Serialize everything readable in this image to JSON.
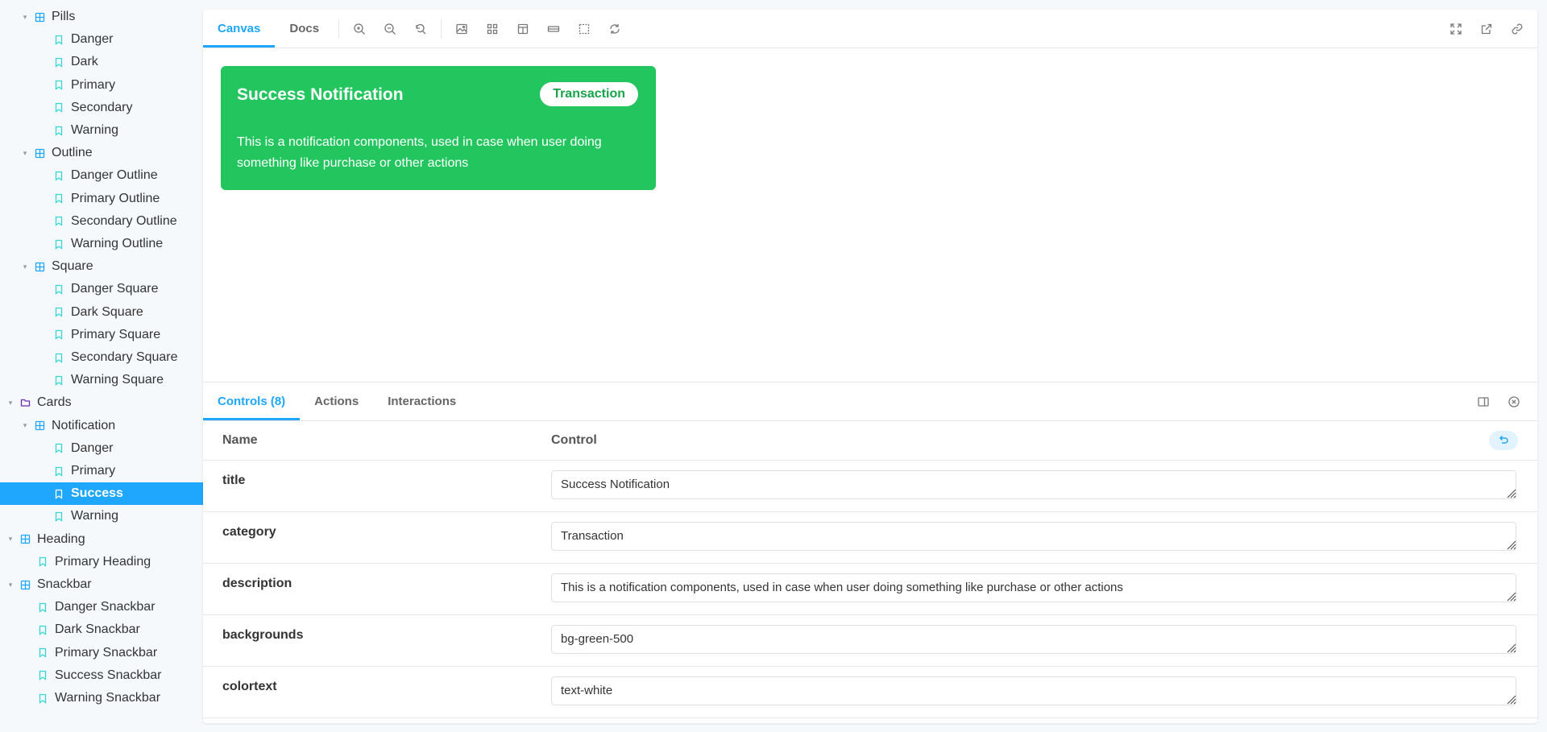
{
  "sidebar": {
    "items": [
      {
        "label": "Pills",
        "type": "component",
        "caret": "▾"
      },
      {
        "label": "Danger",
        "type": "story"
      },
      {
        "label": "Dark",
        "type": "story"
      },
      {
        "label": "Primary",
        "type": "story"
      },
      {
        "label": "Secondary",
        "type": "story"
      },
      {
        "label": "Warning",
        "type": "story"
      },
      {
        "label": "Outline",
        "type": "component",
        "caret": "▾"
      },
      {
        "label": "Danger Outline",
        "type": "story"
      },
      {
        "label": "Primary Outline",
        "type": "story"
      },
      {
        "label": "Secondary Outline",
        "type": "story"
      },
      {
        "label": "Warning Outline",
        "type": "story"
      },
      {
        "label": "Square",
        "type": "component",
        "caret": "▾"
      },
      {
        "label": "Danger Square",
        "type": "story"
      },
      {
        "label": "Dark Square",
        "type": "story"
      },
      {
        "label": "Primary Square",
        "type": "story"
      },
      {
        "label": "Secondary Square",
        "type": "story"
      },
      {
        "label": "Warning Square",
        "type": "story"
      },
      {
        "label": "Cards",
        "type": "folder",
        "caret": "▾"
      },
      {
        "label": "Notification",
        "type": "component",
        "caret": "▾"
      },
      {
        "label": "Danger",
        "type": "story"
      },
      {
        "label": "Primary",
        "type": "story"
      },
      {
        "label": "Success",
        "type": "story",
        "selected": true
      },
      {
        "label": "Warning",
        "type": "story"
      },
      {
        "label": "Heading",
        "type": "component",
        "caret": "▾"
      },
      {
        "label": "Primary Heading",
        "type": "story"
      },
      {
        "label": "Snackbar",
        "type": "component",
        "caret": "▾"
      },
      {
        "label": "Danger Snackbar",
        "type": "story"
      },
      {
        "label": "Dark Snackbar",
        "type": "story"
      },
      {
        "label": "Primary Snackbar",
        "type": "story"
      },
      {
        "label": "Success Snackbar",
        "type": "story"
      },
      {
        "label": "Warning Snackbar",
        "type": "story"
      }
    ]
  },
  "toolbar": {
    "tabs": [
      {
        "label": "Canvas"
      },
      {
        "label": "Docs"
      }
    ],
    "tools": [
      "zoom-in-icon",
      "zoom-out-icon",
      "zoom-reset-icon",
      "background-icon",
      "grid-icon",
      "viewport-icon",
      "measure-icon",
      "outline-icon",
      "remount-icon"
    ],
    "right_tools": [
      "fullscreen-icon",
      "open-new-tab-icon",
      "copy-link-icon"
    ]
  },
  "preview": {
    "title": "Success Notification",
    "category": "Transaction",
    "description": "This is a notification components, used in case when user doing something like purchase or other actions"
  },
  "addons": {
    "tabs": [
      {
        "label": "Controls (8)"
      },
      {
        "label": "Actions"
      },
      {
        "label": "Interactions"
      }
    ],
    "header": {
      "name": "Name",
      "control": "Control"
    },
    "controls": [
      {
        "name": "title",
        "value": "Success Notification"
      },
      {
        "name": "category",
        "value": "Transaction"
      },
      {
        "name": "description",
        "value": "This is a notification components, used in case when user doing something like purchase or other actions"
      },
      {
        "name": "backgrounds",
        "value": "bg-green-500"
      },
      {
        "name": "colortext",
        "value": "text-white"
      }
    ]
  },
  "colors": {
    "accent": "#1ea7fd",
    "card_bg": "#22c55e",
    "story_icon": "#37d5d3",
    "component_icon": "#1ea7fd",
    "folder_icon": "#6f2cac"
  }
}
